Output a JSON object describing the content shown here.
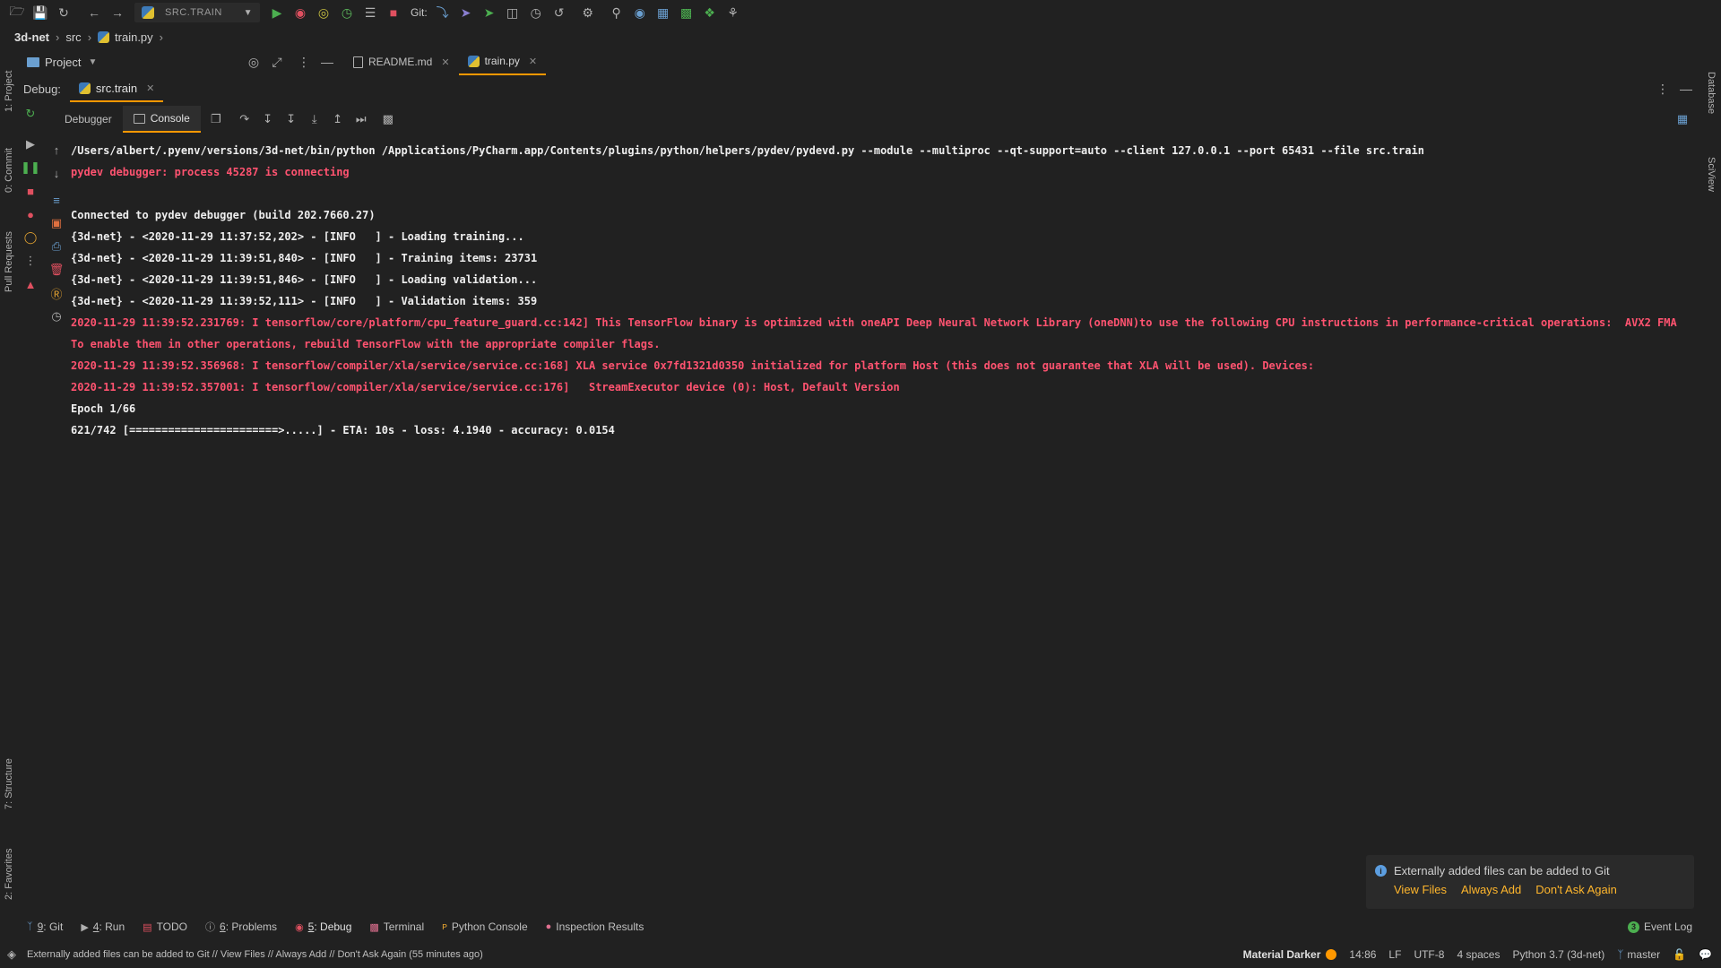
{
  "toolbar": {
    "run_config": "SRC.TRAIN",
    "git_label": "Git:",
    "icons": [
      "open-folder-icon",
      "save-icon",
      "sync-icon",
      "back-arrow-icon",
      "forward-arrow-icon",
      "run-icon",
      "debug-icon",
      "coverage-icon",
      "profile-icon",
      "run-concurrent-icon",
      "stop-icon",
      "git-update-icon",
      "git-commit-icon",
      "git-push-icon",
      "git-compare-icon",
      "git-history-icon",
      "git-rollback-icon",
      "settings-icon",
      "search-icon",
      "target-icon",
      "layout-icon",
      "project-structure-icon",
      "plugins-icon",
      "bug-report-icon"
    ]
  },
  "breadcrumb": {
    "items": [
      "3d-net",
      "src",
      "train.py"
    ]
  },
  "project_panel": {
    "label": "Project"
  },
  "editor_tabs": [
    {
      "label": "README.md",
      "active": false
    },
    {
      "label": "train.py",
      "active": true
    }
  ],
  "debug": {
    "label": "Debug:",
    "session_tab": "src.train",
    "subtabs": [
      {
        "label": "Debugger",
        "active": false
      },
      {
        "label": "Console",
        "active": true
      }
    ]
  },
  "console": {
    "lines": [
      {
        "text": "/Users/albert/.pyenv/versions/3d-net/bin/python /Applications/PyCharm.app/Contents/plugins/python/helpers/pydev/pydevd.py --module --multiproc --qt-support=auto --client 127.0.0.1 --port 65431 --file src.train",
        "style": "white"
      },
      {
        "text": "pydev debugger: process 45287 is connecting",
        "style": "red"
      },
      {
        "text": "",
        "style": "white"
      },
      {
        "text": "Connected to pydev debugger (build 202.7660.27)",
        "style": "white"
      },
      {
        "text": "{3d-net} - <2020-11-29 11:37:52,202> - [INFO   ] - Loading training...",
        "style": "white"
      },
      {
        "text": "{3d-net} - <2020-11-29 11:39:51,840> - [INFO   ] - Training items: 23731",
        "style": "white"
      },
      {
        "text": "{3d-net} - <2020-11-29 11:39:51,846> - [INFO   ] - Loading validation...",
        "style": "white"
      },
      {
        "text": "{3d-net} - <2020-11-29 11:39:52,111> - [INFO   ] - Validation items: 359",
        "style": "white"
      },
      {
        "text": "2020-11-29 11:39:52.231769: I tensorflow/core/platform/cpu_feature_guard.cc:142] This TensorFlow binary is optimized with oneAPI Deep Neural Network Library (oneDNN)to use the following CPU instructions in performance-critical operations:  AVX2 FMA",
        "style": "red"
      },
      {
        "text": "To enable them in other operations, rebuild TensorFlow with the appropriate compiler flags.",
        "style": "red"
      },
      {
        "text": "2020-11-29 11:39:52.356968: I tensorflow/compiler/xla/service/service.cc:168] XLA service 0x7fd1321d0350 initialized for platform Host (this does not guarantee that XLA will be used). Devices:",
        "style": "red"
      },
      {
        "text": "2020-11-29 11:39:52.357001: I tensorflow/compiler/xla/service/service.cc:176]   StreamExecutor device (0): Host, Default Version",
        "style": "red"
      },
      {
        "text": "Epoch 1/66",
        "style": "white"
      },
      {
        "text": "621/742 [=======================>.....] - ETA: 10s - loss: 4.1940 - accuracy: 0.0154",
        "style": "white"
      }
    ]
  },
  "left_strip": {
    "tabs": [
      "1: Project",
      "0: Commit",
      "Pull Requests",
      "7: Structure",
      "2: Favorites"
    ]
  },
  "right_strip": {
    "tabs": [
      "Database",
      "SciView"
    ]
  },
  "notification": {
    "title": "Externally added files can be added to Git",
    "actions": [
      "View Files",
      "Always Add",
      "Don't Ask Again"
    ]
  },
  "tool_windows": [
    {
      "num": "9",
      "label": ": Git",
      "icon": "git-branch-icon"
    },
    {
      "num": "4",
      "label": ": Run",
      "icon": "run-icon"
    },
    {
      "num": "",
      "label": "TODO",
      "icon": "todo-icon"
    },
    {
      "num": "6",
      "label": ": Problems",
      "icon": "problems-icon"
    },
    {
      "num": "5",
      "label": ": Debug",
      "icon": "debug-icon"
    },
    {
      "num": "",
      "label": "Terminal",
      "icon": "terminal-icon"
    },
    {
      "num": "",
      "label": "Python Console",
      "icon": "python-console-icon"
    },
    {
      "num": "",
      "label": "Inspection Results",
      "icon": "inspection-icon"
    }
  ],
  "event_log": {
    "count": "3",
    "label": "Event Log"
  },
  "status_bar": {
    "message": "Externally added files can be added to Git // View Files // Always Add // Don't Ask Again (55 minutes ago)",
    "theme": "Material Darker",
    "position": "14:86",
    "line_sep": "LF",
    "encoding": "UTF-8",
    "indent": "4 spaces",
    "interpreter": "Python 3.7 (3d-net)",
    "branch": "master"
  },
  "colors": {
    "background": "#212121",
    "accent": "#ff9800",
    "error_text": "#ff5370",
    "link": "#ffb62c"
  }
}
